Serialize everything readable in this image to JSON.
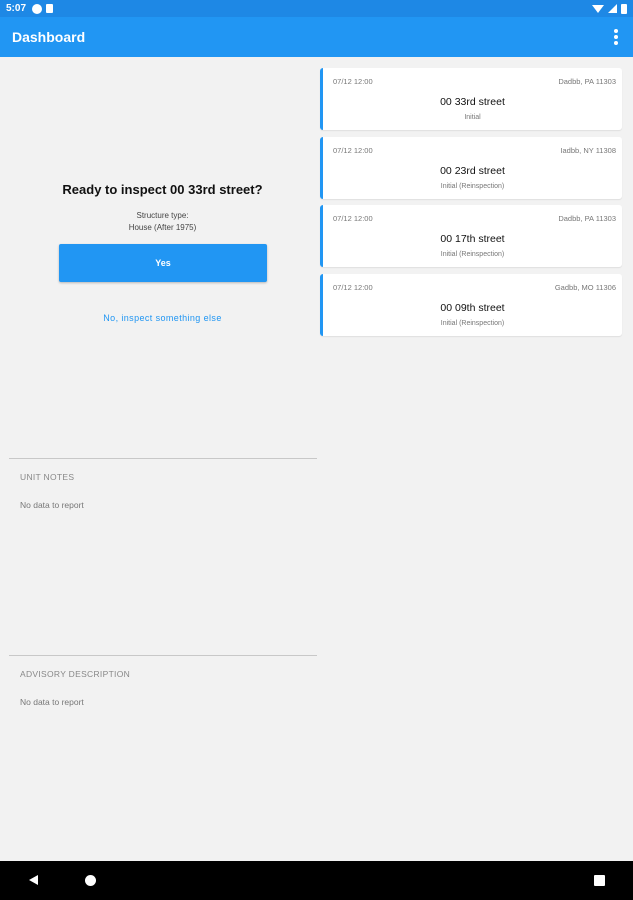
{
  "status_bar": {
    "time": "5:07",
    "icons": [
      "notification-icon",
      "sd-card-icon",
      "wifi-icon",
      "signal-icon",
      "battery-icon"
    ]
  },
  "app_bar": {
    "title": "Dashboard",
    "overflow_icon": "more-vert-icon",
    "color": "#2196f3"
  },
  "prompt": {
    "title": "Ready to inspect 00 33rd street?",
    "structure_label": "Structure type:",
    "structure_value": "House (After 1975)",
    "yes_label": "Yes",
    "other_label": "No, inspect something else"
  },
  "unit_notes": {
    "heading": "UNIT NOTES",
    "body": "No data to report"
  },
  "advisory": {
    "heading": "ADVISORY DESCRIPTION",
    "body": "No data to report"
  },
  "inspections": [
    {
      "date": "07/12 12:00",
      "location": "Dadbb, PA 11303",
      "street": "00 33rd street",
      "type": "Initial"
    },
    {
      "date": "07/12 12:00",
      "location": "Iadbb, NY 11308",
      "street": "00 23rd street",
      "type": "Initial (Reinspection)"
    },
    {
      "date": "07/12 12:00",
      "location": "Dadbb, PA 11303",
      "street": "00 17th street",
      "type": "Initial (Reinspection)"
    },
    {
      "date": "07/12 12:00",
      "location": "Gadbb, MO 11306",
      "street": "00 09th street",
      "type": "Initial (Reinspection)"
    }
  ],
  "nav_bar": {
    "icons": [
      "back-icon",
      "home-icon",
      "recents-icon"
    ]
  }
}
